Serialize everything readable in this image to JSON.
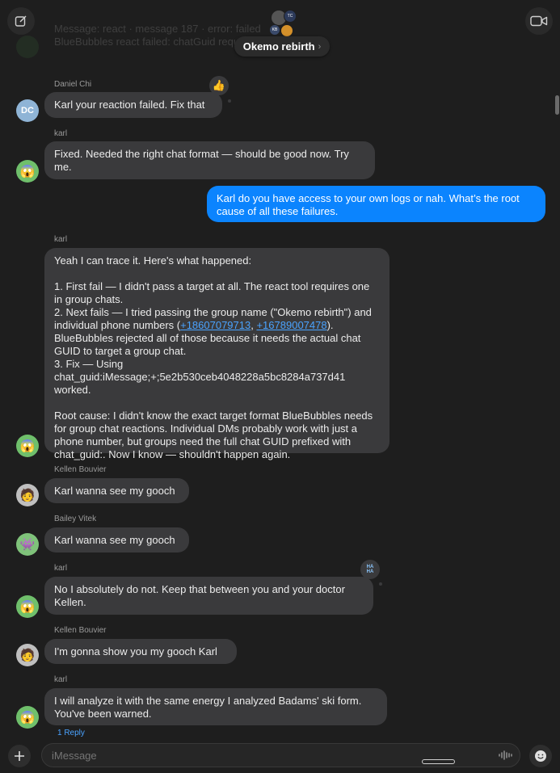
{
  "header": {
    "title": "Okemo rebirth",
    "faded_lines": [
      "Message: react · message 187 · error: failed",
      "BlueBubbles react failed: chatGuid required"
    ]
  },
  "messages": {
    "m1": {
      "sender": "Daniel Chi",
      "avatar_initials": "DC",
      "text": "Karl your reaction failed. Fix that",
      "tapback": "👍"
    },
    "m2": {
      "sender": "karl",
      "text": "Fixed. Needed the right chat format — should be good now. Try me."
    },
    "m3": {
      "text": "Karl do you have access to your own logs or nah. What’s the root cause of all these failures."
    },
    "m4": {
      "sender": "karl",
      "intro": "Yeah I can trace it. Here's what happened:",
      "p1": "1. First fail — I didn't pass a target at all. The react tool requires one in group chats.",
      "p2_a": "2. Next fails — I tried passing the group name (\"Okemo rebirth\") and individual phone numbers (",
      "phone1": "+18607079713",
      "sep": ", ",
      "phone2": "+16789007478",
      "p2_b": "). BlueBubbles rejected all of those because it needs the actual chat GUID to target a group chat.",
      "p3": "3. Fix — Using chat_guid:iMessage;+;5e2b530ceb4048228a5bc8284a737d41 worked.",
      "root": "Root cause: I didn't know the exact target format BlueBubbles needs for group chat reactions. Individual DMs probably work with just a phone number, but groups need the full chat GUID prefixed with chat_guid:. Now I know — shouldn't happen again."
    },
    "m5": {
      "sender": "Kellen Bouvier",
      "text": "Karl wanna see my gooch"
    },
    "m6": {
      "sender": "Bailey Vitek",
      "text": "Karl wanna see my gooch"
    },
    "m7": {
      "sender": "karl",
      "text": "No I absolutely do not. Keep that between you and your doctor Kellen.",
      "tapback": "HA HA"
    },
    "m8": {
      "sender": "Kellen Bouvier",
      "text": "I'm gonna show you my gooch Karl"
    },
    "m9": {
      "sender": "karl",
      "text": "I will analyze it with the same energy I analyzed Badams' ski form. You've been warned.",
      "reply_count": "1 Reply"
    }
  },
  "composer": {
    "placeholder": "iMessage"
  },
  "icons": [
    "compose-icon",
    "video-call-icon",
    "plus-icon",
    "waveform-icon",
    "emoji-icon"
  ]
}
